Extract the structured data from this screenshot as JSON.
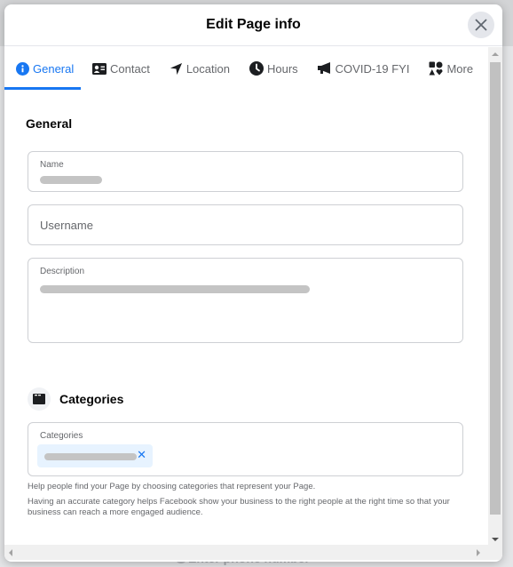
{
  "dialog": {
    "title": "Edit Page info",
    "close_icon": "close-icon"
  },
  "tabs": [
    {
      "label": "General",
      "icon": "info-icon",
      "active": true
    },
    {
      "label": "Contact",
      "icon": "contact-card-icon",
      "active": false
    },
    {
      "label": "Location",
      "icon": "location-arrow-icon",
      "active": false
    },
    {
      "label": "Hours",
      "icon": "clock-icon",
      "active": false
    },
    {
      "label": "COVID-19 FYI",
      "icon": "megaphone-icon",
      "active": false
    },
    {
      "label": "More",
      "icon": "shapes-icon",
      "active": false
    }
  ],
  "general": {
    "section_title": "General",
    "name": {
      "label": "Name",
      "value": "[redacted]"
    },
    "username": {
      "placeholder": "Username"
    },
    "description": {
      "label": "Description",
      "value": "[redacted]"
    }
  },
  "categories": {
    "section_title": "Categories",
    "field_label": "Categories",
    "chip_value": "[redacted]",
    "help_1": "Help people find your Page by choosing categories that represent your Page.",
    "help_2": "Having an accurate category helps Facebook show your business to the right people at the right time so that your business can reach a more engaged audience."
  },
  "background": {
    "phone_placeholder": "Enter phone number"
  },
  "colors": {
    "accent": "#1877f2",
    "chip_bg": "#e7f3ff",
    "secondary_text": "#65676b"
  }
}
